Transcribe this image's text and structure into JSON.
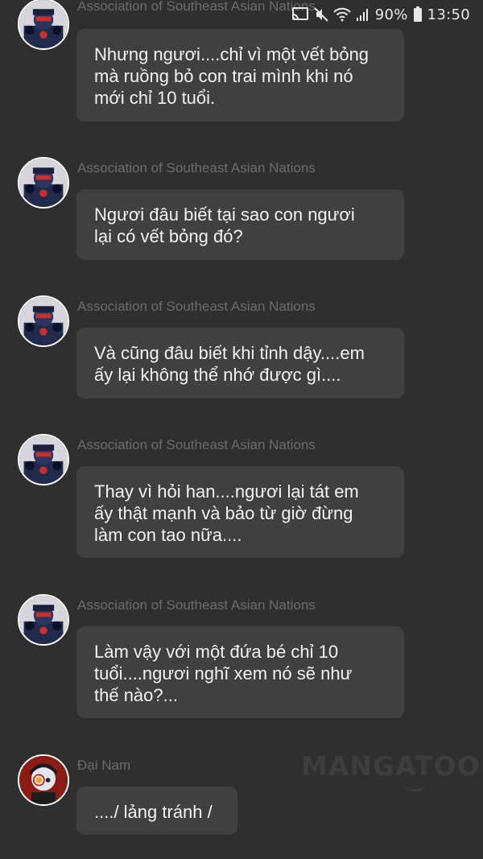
{
  "status_bar": {
    "battery": "90%",
    "time": "13:50",
    "icons": [
      "cast-icon",
      "mute-icon",
      "wifi-icon",
      "signal-icon",
      "battery-icon"
    ]
  },
  "messages": [
    {
      "sender": "Association of Southeast Asian Nations",
      "avatar": "asean-avatar",
      "lines": [
        "Nhưng ngươi....chỉ vì một vết bỏng",
        "mà ruồng bỏ con trai mình khi nó",
        "mới chỉ 10 tuổi."
      ]
    },
    {
      "sender": "Association of Southeast Asian Nations",
      "avatar": "asean-avatar",
      "lines": [
        "Ngươi đâu biết tại sao con ngươi",
        "lại có vết bỏng đó?"
      ]
    },
    {
      "sender": "Association of Southeast Asian Nations",
      "avatar": "asean-avatar",
      "lines": [
        "Và cũng đâu biết khi tỉnh dậy....em",
        "ấy lại không thể nhớ được gì...."
      ]
    },
    {
      "sender": "Association of Southeast Asian Nations",
      "avatar": "asean-avatar",
      "lines": [
        "Thay vì hỏi han....ngươi lại tát em",
        "ấy thật mạnh và bảo từ giờ đừng",
        "làm con tao nữa...."
      ]
    },
    {
      "sender": "Association of Southeast Asian Nations",
      "avatar": "asean-avatar",
      "lines": [
        "Làm vậy với một đứa bé chỉ 10",
        "tuổi....ngươi nghĩ xem nó sẽ như",
        "thế nào?..."
      ]
    },
    {
      "sender": "Đại Nam",
      "avatar": "dai-nam-avatar",
      "lines": [
        "..../ lảng tránh /"
      ]
    }
  ],
  "watermark": "MANGATOON",
  "colors": {
    "background": "#2f2f2f",
    "bubble": "#404040",
    "sender_text": "#6c6c6c",
    "message_text": "#f2f2f2"
  }
}
